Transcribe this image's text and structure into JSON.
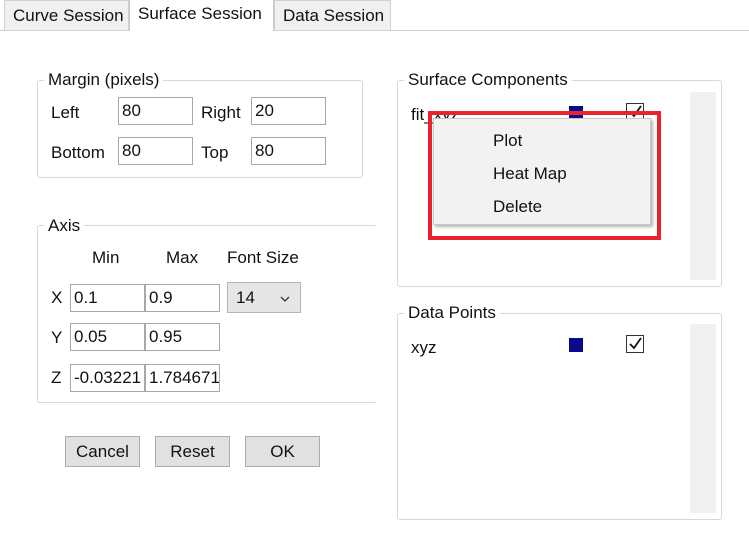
{
  "tabs": [
    {
      "label": "Curve Session"
    },
    {
      "label": "Surface Session"
    },
    {
      "label": "Data Session"
    }
  ],
  "margin": {
    "legend": "Margin (pixels)",
    "left_label": "Left",
    "left_value": "80",
    "right_label": "Right",
    "right_value": "20",
    "bottom_label": "Bottom",
    "bottom_value": "80",
    "top_label": "Top",
    "top_value": "80"
  },
  "axis": {
    "legend": "Axis",
    "col_min": "Min",
    "col_max": "Max",
    "col_font": "Font Size",
    "rows": [
      {
        "label": "X",
        "min": "0.1",
        "max": "0.9"
      },
      {
        "label": "Y",
        "min": "0.05",
        "max": "0.95"
      },
      {
        "label": "Z",
        "min": "-0.03221",
        "max": "1.784671"
      }
    ],
    "font_size_value": "14"
  },
  "buttons": {
    "cancel": "Cancel",
    "reset": "Reset",
    "ok": "OK"
  },
  "surface_components": {
    "legend": "Surface Components",
    "items": [
      {
        "name": "fit_xyz",
        "color": "#0a0a8c",
        "checked": true
      }
    ]
  },
  "data_points": {
    "legend": "Data Points",
    "items": [
      {
        "name": "xyz",
        "color": "#0a0a8c",
        "checked": true
      }
    ]
  },
  "context_menu": {
    "items": [
      {
        "label": "Plot"
      },
      {
        "label": "Heat Map"
      },
      {
        "label": "Delete"
      }
    ]
  },
  "colors": {
    "highlight": "#e8232b",
    "swatch": "#0a0a8c"
  }
}
